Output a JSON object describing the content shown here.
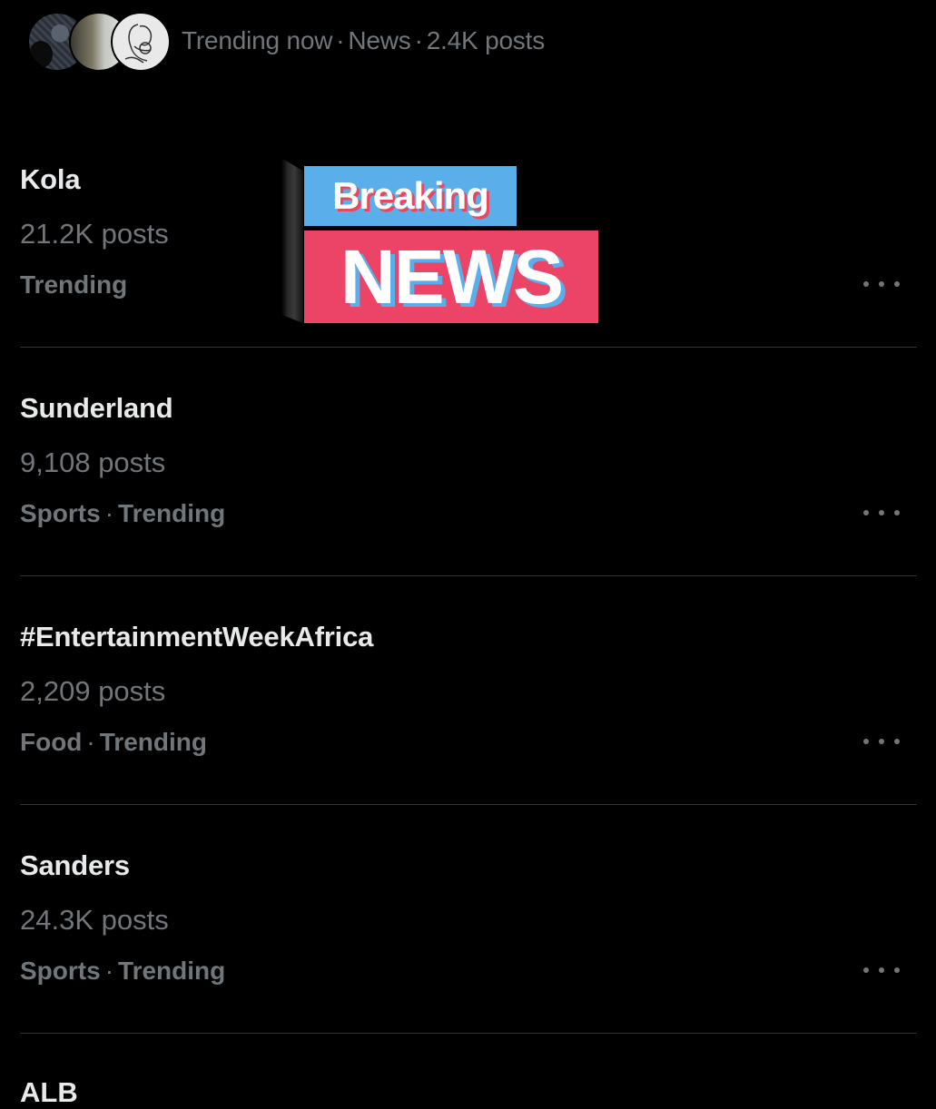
{
  "header": {
    "label": "Trending now",
    "category": "News",
    "post_count": "2.4K posts",
    "separator": "·",
    "avatars": [
      "avatar-1",
      "avatar-2",
      "avatar-3"
    ]
  },
  "trends": [
    {
      "name": "Kola",
      "count": "21.2K posts",
      "category": "",
      "status": "Trending"
    },
    {
      "name": "Sunderland",
      "count": "9,108 posts",
      "category": "Sports",
      "status": "Trending"
    },
    {
      "name": "#EntertainmentWeekAfrica",
      "count": "2,209 posts",
      "category": "Food",
      "status": "Trending"
    },
    {
      "name": "Sanders",
      "count": "24.3K posts",
      "category": "Sports",
      "status": "Trending"
    }
  ],
  "partial_next_trend": "ALB",
  "breaking_news": {
    "line1": "Breaking",
    "line2": "NEWS"
  },
  "colors": {
    "background": "#000000",
    "primary_text": "#e7e9ea",
    "secondary_text": "#71767b",
    "divider": "#2f3336",
    "breaking_blue": "#5aaee9",
    "breaking_red": "#ec4466"
  },
  "icons": {
    "more": "more-horizontal-icon"
  }
}
